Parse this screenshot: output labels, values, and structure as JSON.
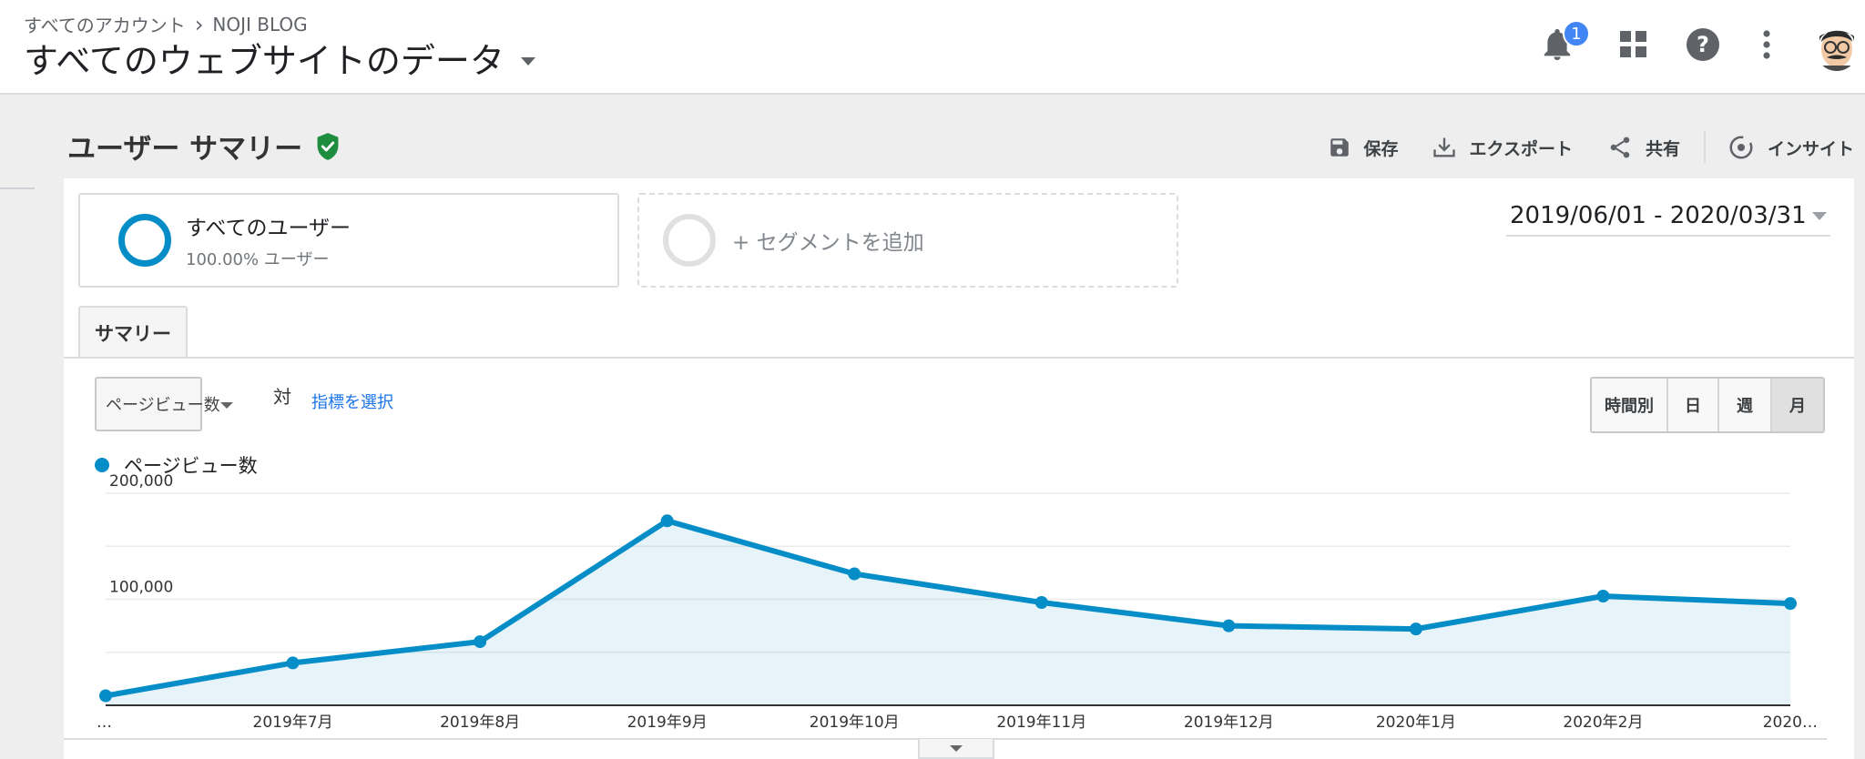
{
  "header": {
    "breadcrumb": [
      "すべてのアカウント",
      "NOJI BLOG"
    ],
    "view_title": "すべてのウェブサイトのデータ",
    "notification_count": "1",
    "icons": [
      "notifications-icon",
      "apps-grid-icon",
      "help-icon",
      "more-vert-icon",
      "account-avatar"
    ]
  },
  "report": {
    "title": "ユーザー サマリー",
    "actions": {
      "save": "保存",
      "export": "エクスポート",
      "share": "共有",
      "insights": "インサイト"
    }
  },
  "segments": {
    "active": {
      "name": "すべてのユーザー",
      "sub": "100.00% ユーザー"
    },
    "add": "+ セグメントを追加"
  },
  "date_range": "2019/06/01 - 2020/03/31",
  "tabs": [
    "サマリー"
  ],
  "controls": {
    "metric_select": "ページビュー数",
    "vs": "対",
    "select_metric_link": "指標を選択",
    "granularity": [
      "時間別",
      "日",
      "週",
      "月"
    ],
    "granularity_selected": "月"
  },
  "colors": {
    "accent": "#058dc7",
    "segment_empty": "#e0e0e0",
    "verified": "#1e8e3e",
    "badge": "#4285f4",
    "link": "#1a73e8"
  },
  "chart_data": {
    "type": "area",
    "title": "",
    "series": [
      {
        "name": "ページビュー数",
        "values": [
          9000,
          40000,
          60000,
          174000,
          124000,
          97000,
          75000,
          72000,
          103000,
          96000
        ]
      }
    ],
    "x": [
      "…",
      "2019年7月",
      "2019年8月",
      "2019年9月",
      "2019年10月",
      "2019年11月",
      "2019年12月",
      "2020年1月",
      "2020年2月",
      "2020…"
    ],
    "yticks": [
      "100,000",
      "200,000"
    ],
    "ylim": [
      0,
      200000
    ],
    "grid": true,
    "legend": "top-left"
  }
}
